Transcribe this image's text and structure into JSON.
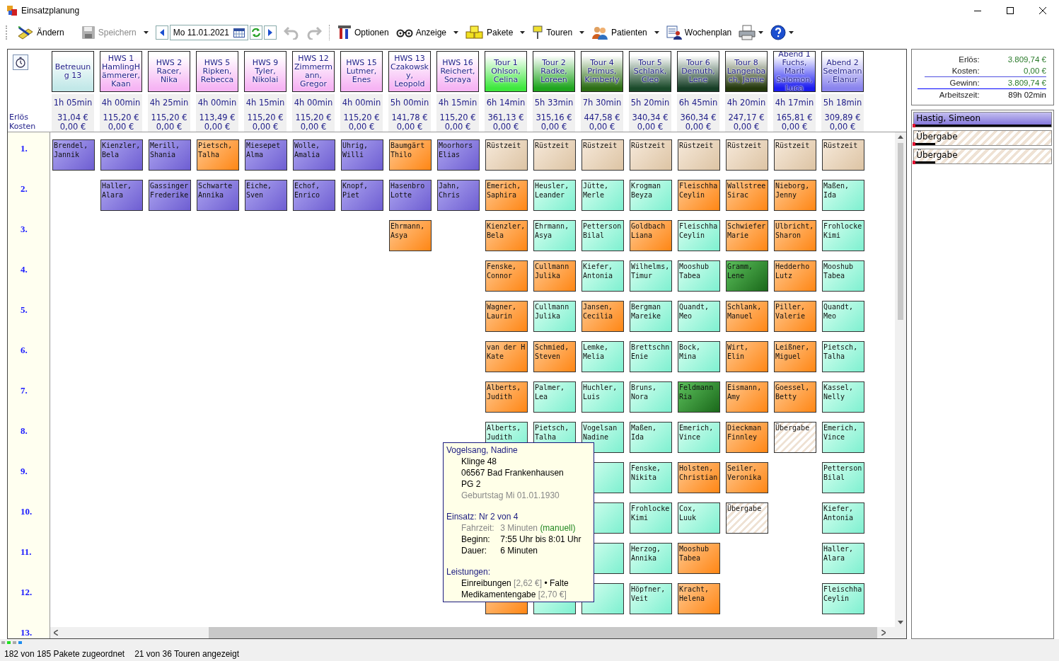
{
  "window": {
    "title": "Einsatzplanung"
  },
  "toolbar": [
    {
      "kind": "button",
      "label": "Ändern",
      "disabled": false,
      "menu": false
    },
    {
      "kind": "button",
      "label": "Speichern",
      "disabled": true,
      "menu": true
    },
    {
      "kind": "date",
      "value": "Mo 11.01.2021"
    },
    {
      "kind": "button",
      "disabled": true,
      "menu": false
    },
    {
      "kind": "button",
      "disabled": true,
      "menu": false
    },
    {
      "kind": "button",
      "label": "Optionen",
      "disabled": false,
      "menu": false
    },
    {
      "kind": "button",
      "label": "Anzeige",
      "disabled": false,
      "menu": true
    },
    {
      "kind": "button",
      "label": "Pakete",
      "disabled": false,
      "menu": true
    },
    {
      "kind": "button",
      "label": "Touren",
      "disabled": false,
      "menu": true
    },
    {
      "kind": "button",
      "label": "Patienten",
      "disabled": false,
      "menu": true
    },
    {
      "kind": "button",
      "label": "Wochenplan",
      "disabled": false,
      "menu": false
    },
    {
      "kind": "button",
      "disabled": false,
      "menu": true
    },
    {
      "kind": "button",
      "disabled": false,
      "menu": true
    }
  ],
  "grid": {
    "stat_labels": [
      "Erlös",
      "Kosten"
    ],
    "row_labels": [
      "1.",
      "2.",
      "3.",
      "4.",
      "5.",
      "6.",
      "7.",
      "8.",
      "9.",
      "10.",
      "11.",
      "12.",
      "13."
    ],
    "columns": [
      {
        "title": "Betreuung 13",
        "color": "#c2e8e8",
        "duration": "1h 05min",
        "revenue": "31,04 €",
        "costs": "0,00 €",
        "cells": [
          {
            "name": "Brendel,\nJannik",
            "kind": "purple"
          },
          null,
          null,
          null,
          null,
          null,
          null,
          null,
          null,
          null,
          null,
          null
        ]
      },
      {
        "title": "HWS 1 HamlingHämmerer, Kaan",
        "color": "#f6b4f4",
        "duration": "4h 00min",
        "revenue": "115,20 €",
        "costs": "0,00 €",
        "cells": [
          {
            "name": "Kienzler,\nBela",
            "kind": "purple"
          },
          {
            "name": "Haller,\nAlara",
            "kind": "purple"
          },
          null,
          null,
          null,
          null,
          null,
          null,
          null,
          null,
          null,
          null
        ]
      },
      {
        "title": "HWS 2 Racer, Nika",
        "color": "#f6b4f4",
        "duration": "4h 25min",
        "revenue": "115,20 €",
        "costs": "0,00 €",
        "cells": [
          {
            "name": "Merill,\nShania",
            "kind": "purple"
          },
          {
            "name": "Gassinger\nFrederike",
            "kind": "purple"
          },
          null,
          null,
          null,
          null,
          null,
          null,
          null,
          null,
          null,
          null
        ]
      },
      {
        "title": "HWS 5 Ripken, Rebecca",
        "color": "#f6b4f4",
        "duration": "4h 00min",
        "revenue": "113,49 €",
        "costs": "0,00 €",
        "cells": [
          {
            "name": "Pietsch,\nTalha",
            "kind": "orange"
          },
          {
            "name": "Schwarte\nAnnika",
            "kind": "purple"
          },
          null,
          null,
          null,
          null,
          null,
          null,
          null,
          null,
          null,
          null
        ]
      },
      {
        "title": "HWS 9 Tyler, Nikolai",
        "color": "#f6b4f4",
        "duration": "4h 15min",
        "revenue": "115,20 €",
        "costs": "0,00 €",
        "cells": [
          {
            "name": "Miesepet\nAlma",
            "kind": "purple"
          },
          {
            "name": "Eiche,\nSven",
            "kind": "purple"
          },
          null,
          null,
          null,
          null,
          null,
          null,
          null,
          null,
          null,
          null
        ]
      },
      {
        "title": "HWS 12 Zimmermann, Gregor",
        "color": "#f6b4f4",
        "duration": "4h 00min",
        "revenue": "115,20 €",
        "costs": "0,00 €",
        "cells": [
          {
            "name": "Wolle,\nAmalia",
            "kind": "purple"
          },
          {
            "name": "Echof,\nEnrico",
            "kind": "purple"
          },
          null,
          null,
          null,
          null,
          null,
          null,
          null,
          null,
          null,
          null
        ]
      },
      {
        "title": "HWS 15 Lutmer, Enes",
        "color": "#f6b4f4",
        "duration": "4h 00min",
        "revenue": "115,20 €",
        "costs": "0,00 €",
        "cells": [
          {
            "name": "Uhrig,\nWilli",
            "kind": "purple"
          },
          {
            "name": "Knopf,\nPiet",
            "kind": "purple"
          },
          null,
          null,
          null,
          null,
          null,
          null,
          null,
          null,
          null,
          null
        ]
      },
      {
        "title": "HWS 13 Czakowsky, Leopold",
        "color": "#f6b4f4",
        "duration": "5h 00min",
        "revenue": "141,78 €",
        "costs": "0,00 €",
        "cells": [
          {
            "name": "Baumgärt\nThilo",
            "kind": "orange"
          },
          {
            "name": "Hasenbro\nLotte",
            "kind": "purple"
          },
          {
            "name": "Ehrmann,\nAsya",
            "kind": "orange"
          },
          null,
          null,
          null,
          null,
          null,
          null,
          null,
          null,
          null
        ]
      },
      {
        "title": "HWS 16 Reichert, Soraya",
        "color": "#f6b4f4",
        "duration": "4h 15min",
        "revenue": "115,20 €",
        "costs": "0,00 €",
        "cells": [
          {
            "name": "Moorhors\nElias",
            "kind": "purple"
          },
          {
            "name": "Jahn,\nChris",
            "kind": "purple"
          },
          null,
          null,
          null,
          null,
          null,
          null,
          null,
          null,
          null,
          null
        ]
      },
      {
        "title": "Tour 1 Ohlson, Celina",
        "color": "#3ee83e",
        "duration": "6h 14min",
        "revenue": "361,13 €",
        "costs": "0,00 €",
        "cells": [
          {
            "name": "Rüstzeit",
            "kind": "tan"
          },
          {
            "name": "Emerich,\nSaphira",
            "kind": "orange"
          },
          {
            "name": "Kienzler,\nBela",
            "kind": "orange"
          },
          {
            "name": "Fenske,\nConnor",
            "kind": "orange"
          },
          {
            "name": "Wagner,\nLaurin",
            "kind": "orange"
          },
          {
            "name": "van der H\nKate",
            "kind": "orange"
          },
          {
            "name": "Alberts,\nJudith",
            "kind": "orange"
          },
          {
            "name": "Alberts,\nJudith",
            "kind": "teal"
          },
          null,
          null,
          null,
          {
            "kind": "orange"
          }
        ]
      },
      {
        "title": "Tour 2 Radke, Loreen",
        "color": "#1fa51f",
        "duration": "5h 33min",
        "revenue": "315,16 €",
        "costs": "0,00 €",
        "cells": [
          {
            "name": "Rüstzeit",
            "kind": "tan"
          },
          {
            "name": "Heusler,\nLeander",
            "kind": "teal"
          },
          {
            "name": "Ehrmann,\nAsya",
            "kind": "teal"
          },
          {
            "name": "Cullmann\nJulika",
            "kind": "orange"
          },
          {
            "name": "Cullmann\nJulika",
            "kind": "teal"
          },
          {
            "name": "Schmied,\nSteven",
            "kind": "orange"
          },
          {
            "name": "Palmer,\nLea",
            "kind": "teal"
          },
          {
            "name": "Pietsch,\nTalha",
            "kind": "teal"
          },
          null,
          null,
          null,
          {
            "kind": "teal"
          }
        ]
      },
      {
        "title": "Tour 4 Primus, Kimberly",
        "color": "#2c6e14",
        "duration": "7h 30min",
        "revenue": "447,58 €",
        "costs": "0,00 €",
        "cells": [
          {
            "name": "Rüstzeit",
            "kind": "tan"
          },
          {
            "name": "Jütte,\nMerle",
            "kind": "teal"
          },
          {
            "name": "Petterson\nBilal",
            "kind": "teal"
          },
          {
            "name": "Kiefer,\nAntonia",
            "kind": "teal"
          },
          {
            "name": "Jansen,\nCecilia",
            "kind": "orange"
          },
          {
            "name": "Lemke,\nMelia",
            "kind": "teal"
          },
          {
            "name": "Huchler,\nLuis",
            "kind": "teal"
          },
          {
            "name": "Vogelsan\nNadine",
            "kind": "teal"
          },
          {
            "kind": "teal"
          },
          {
            "kind": "teal"
          },
          {
            "kind": "teal"
          },
          {
            "kind": "teal"
          }
        ]
      },
      {
        "title": "Tour 5 Schlank, Cleo",
        "color": "#1a4a2a",
        "duration": "5h 20min",
        "revenue": "340,34 €",
        "costs": "0,00 €",
        "cells": [
          {
            "name": "Rüstzeit",
            "kind": "tan"
          },
          {
            "name": "Krogman\nBeyza",
            "kind": "teal"
          },
          {
            "name": "Goldbach\nLiana",
            "kind": "orange"
          },
          {
            "name": "Wilhelms,\nTimur",
            "kind": "teal"
          },
          {
            "name": "Bergman\nMareike",
            "kind": "teal"
          },
          {
            "name": "Brettschn\nEnie",
            "kind": "teal"
          },
          {
            "name": "Bruns,\nNora",
            "kind": "teal"
          },
          {
            "name": "Maßen,\nIda",
            "kind": "teal"
          },
          {
            "name": "Fenske,\nNikita",
            "kind": "teal"
          },
          {
            "name": "Frohlocke\nKimi",
            "kind": "teal"
          },
          {
            "name": "Herzog,\nAnnika",
            "kind": "teal"
          },
          {
            "name": "Höpfner,\nVeit",
            "kind": "teal"
          }
        ]
      },
      {
        "title": "Tour 6 Demuth, Lene",
        "color": "#163e26",
        "duration": "6h 45min",
        "revenue": "360,34 €",
        "costs": "0,00 €",
        "cells": [
          {
            "name": "Rüstzeit",
            "kind": "tan"
          },
          {
            "name": "Fleischha\nCeylin",
            "kind": "orange"
          },
          {
            "name": "Fleischha\nCeylin",
            "kind": "teal"
          },
          {
            "name": "Mooshub\nTabea",
            "kind": "teal"
          },
          {
            "name": "Quandt,\nMeo",
            "kind": "teal"
          },
          {
            "name": "Bock,\nMina",
            "kind": "teal"
          },
          {
            "name": "Feldmann\nRia",
            "kind": "green"
          },
          {
            "name": "Emerich,\nVince",
            "kind": "teal"
          },
          {
            "name": "Holsten,\nChristian",
            "kind": "orange"
          },
          {
            "name": "Cox,\nLuuk",
            "kind": "teal"
          },
          {
            "name": "Mooshub\nTabea",
            "kind": "orange"
          },
          {
            "name": "Kracht,\nHelena",
            "kind": "orange"
          }
        ]
      },
      {
        "title": "Tour 8 Langenbach, Jamie",
        "color": "#24380c",
        "duration": "4h 20min",
        "revenue": "247,17 €",
        "costs": "0,00 €",
        "cells": [
          {
            "name": "Rüstzeit",
            "kind": "tan"
          },
          {
            "name": "Wallstree\nSirac",
            "kind": "orange"
          },
          {
            "name": "Schwiefer\nMarie",
            "kind": "orange"
          },
          {
            "name": "Gramm,\nLene",
            "kind": "green"
          },
          {
            "name": "Schlank,\nManuel",
            "kind": "orange"
          },
          {
            "name": "Wirt,\nElin",
            "kind": "orange"
          },
          {
            "name": "Eismann,\nAmy",
            "kind": "orange"
          },
          {
            "name": "Dieckman\nFinnley",
            "kind": "orange"
          },
          {
            "name": "Seiler,\nVeronika",
            "kind": "orange"
          },
          {
            "name": "Übergabe",
            "kind": "handover"
          },
          null,
          null
        ]
      },
      {
        "title": "Abend 1 Fuchs, Marit Salomon, Luca",
        "color": "#1c1cf0",
        "duration": "4h 17min",
        "revenue": "165,81 €",
        "costs": "0,00 €",
        "cells": [
          {
            "name": "Rüstzeit",
            "kind": "tan"
          },
          {
            "name": "Nieborg,\nJenny",
            "kind": "orange"
          },
          {
            "name": "Ulbricht,\nSharon",
            "kind": "orange"
          },
          {
            "name": "Hedderho\nLutz",
            "kind": "orange"
          },
          {
            "name": "Piller,\nValerie",
            "kind": "orange"
          },
          {
            "name": "Leißner,\nMiguel",
            "kind": "orange"
          },
          {
            "name": "Goessel,\nBetty",
            "kind": "orange"
          },
          {
            "name": "Übergabe",
            "kind": "handover"
          },
          null,
          null,
          null,
          null
        ]
      },
      {
        "title": "Abend 2 Seelmann, Elanur",
        "color": "#8a84ee",
        "duration": "5h 18min",
        "revenue": "309,89 €",
        "costs": "0,00 €",
        "cells": [
          {
            "name": "Rüstzeit",
            "kind": "tan"
          },
          {
            "name": "Maßen,\nIda",
            "kind": "teal"
          },
          {
            "name": "Frohlocke\nKimi",
            "kind": "teal"
          },
          {
            "name": "Mooshub\nTabea",
            "kind": "teal"
          },
          {
            "name": "Quandt,\nMeo",
            "kind": "teal"
          },
          {
            "name": "Pietsch,\nTalha",
            "kind": "teal"
          },
          {
            "name": "Kassel,\nNelly",
            "kind": "teal"
          },
          {
            "name": "Emerich,\nVince",
            "kind": "teal"
          },
          {
            "name": "Petterson\nBilal",
            "kind": "teal"
          },
          {
            "name": "Kiefer,\nAntonia",
            "kind": "teal"
          },
          {
            "name": "Haller,\nAlara",
            "kind": "teal"
          },
          {
            "name": "Fleischha\nCeylin",
            "kind": "teal"
          }
        ]
      }
    ]
  },
  "tooltip": {
    "title": "Vogelsang, Nadine",
    "address": [
      "Klinge 48",
      "06567 Bad Frankenhausen",
      "PG 2"
    ],
    "birthday": "Geburtstag Mi 01.01.1930",
    "assignment": {
      "label": "Einsatz:",
      "value": "Nr 2 von 4"
    },
    "details": [
      {
        "label": "Fahrzeit:",
        "value": "3 Minuten",
        "note": "(manuell)",
        "muted": true
      },
      {
        "label": "Beginn:",
        "value": "7:55 Uhr bis 8:01 Uhr",
        "muted": false
      },
      {
        "label": "Dauer:",
        "value": "6 Minuten",
        "muted": false
      }
    ],
    "services_label": "Leistungen:",
    "services": [
      {
        "name": "Einreibungen",
        "price": "[2,62 €]",
        "extra": "• Falte"
      },
      {
        "name": "Medikamentengabe",
        "price": "[2,70 €]"
      }
    ]
  },
  "summary": [
    {
      "label": "Erlös:",
      "value": "3.809,74 €",
      "kind": "money"
    },
    {
      "label": "Kosten:",
      "value": "0,00 €",
      "kind": "money"
    },
    {
      "label": "Gewinn:",
      "value": "3.809,74 €",
      "kind": "money"
    },
    {
      "label": "Arbeitszeit:",
      "value": "89h 02min",
      "kind": "time"
    }
  ],
  "unassigned": [
    {
      "label": "Hastig, Simeon",
      "kind": "tour"
    },
    {
      "label": "Übergabe",
      "kind": "handover"
    },
    {
      "label": "Übergabe",
      "kind": "handover"
    }
  ],
  "status_bar": [
    "182 von 185 Pakete zugeordnet",
    "21 von 36 Touren angezeigt"
  ]
}
